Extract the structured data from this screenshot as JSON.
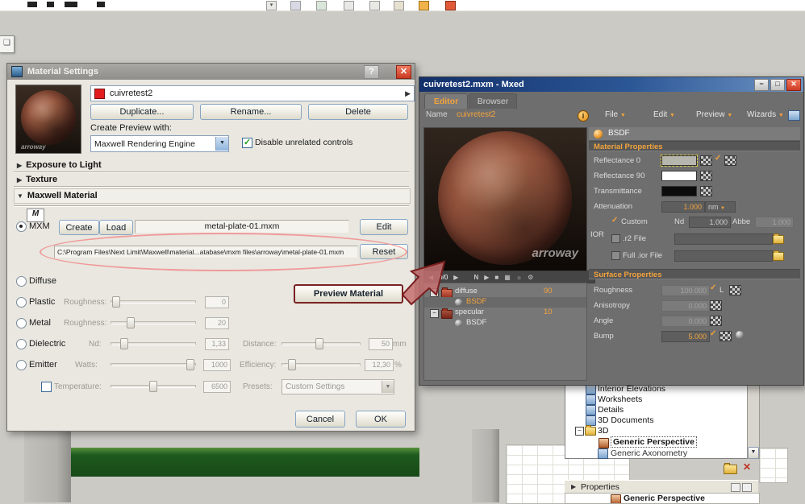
{
  "watermark": "arroway",
  "ms": {
    "title": "Material Settings",
    "name_value": "cuivretest2",
    "duplicate": "Duplicate...",
    "rename": "Rename...",
    "delete": "Delete",
    "create_preview_label": "Create Preview with:",
    "engine": "Maxwell Rendering Engine",
    "disable_controls": "Disable unrelated controls",
    "section_exposure": "Exposure to Light",
    "section_texture": "Texture",
    "section_maxwell": "Maxwell Material",
    "mxm_label": "MXM",
    "create": "Create",
    "load": "Load",
    "mxm_file": "metal-plate-01.mxm",
    "edit": "Edit",
    "mxm_path": "C:\\Program Files\\Next Limit\\Maxwell\\material...atabase\\mxm files\\arroway\\metal-plate-01.mxm",
    "reset": "Reset",
    "diffuse": "Diffuse",
    "plastic": "Plastic",
    "plastic_param": "Roughness:",
    "plastic_value": "0",
    "metal": "Metal",
    "metal_param": "Roughness:",
    "metal_value": "20",
    "dielectric": "Dielectric",
    "dielectric_param": "Nd:",
    "dielectric_value": "1,33",
    "distance_label": "Distance:",
    "distance_value": "50",
    "distance_unit": "mm",
    "emitter": "Emitter",
    "emitter_param": "Watts:",
    "emitter_value": "1000",
    "efficiency_label": "Efficiency:",
    "efficiency_value": "12,30",
    "efficiency_unit": "%",
    "temperature_label": "Temperature:",
    "temperature_value": "6500",
    "presets_label": "Presets:",
    "presets_value": "Custom Settings",
    "preview_material": "Preview Material",
    "cancel": "Cancel",
    "ok": "OK"
  },
  "mx": {
    "title": "cuivretest2.mxm - Mxed",
    "tab_editor": "Editor",
    "tab_browser": "Browser",
    "name_label": "Name",
    "name_value": "cuivretest2",
    "menu_file": "File",
    "menu_edit": "Edit",
    "menu_preview": "Preview",
    "menu_wizards": "Wizards",
    "counter": "0/0",
    "bsdf": "BSDF",
    "material_properties": "Material Properties",
    "reflectance0": "Reflectance 0",
    "reflectance90": "Reflectance 90",
    "transmittance": "Transmittance",
    "attenuation": "Attenuation",
    "attenuation_value": "1.000",
    "attenuation_unit": "nm",
    "ior": "IOR",
    "custom": "Custom",
    "nd": "Nd",
    "nd_value": "1.000",
    "abbe": "Abbe",
    "abbe_value": "1.000",
    "r2_file": ".r2 File",
    "full_ior": "Full .ior File",
    "surface_properties": "Surface Properties",
    "roughness": "Roughness",
    "roughness_value": "100.000",
    "roughness_l": "L",
    "anisotropy": "Anisotropy",
    "anisotropy_value": "0.000",
    "angle": "Angle",
    "angle_value": "0.000",
    "bump": "Bump",
    "bump_value": "5.000",
    "layers": [
      {
        "name": "diffuse",
        "value": "90"
      },
      {
        "name": "BSDF",
        "value": ""
      },
      {
        "name": "specular",
        "value": "10"
      },
      {
        "name": "BSDF",
        "value": ""
      }
    ]
  },
  "nav": {
    "items": [
      {
        "label": "Interior Elevations"
      },
      {
        "label": "Worksheets"
      },
      {
        "label": "Details"
      },
      {
        "label": "3D Documents"
      },
      {
        "label": "3D"
      },
      {
        "label": "Generic Perspective"
      },
      {
        "label": "Generic Axonometry"
      }
    ],
    "properties": "Properties",
    "bottom_item": "Generic Perspective"
  }
}
